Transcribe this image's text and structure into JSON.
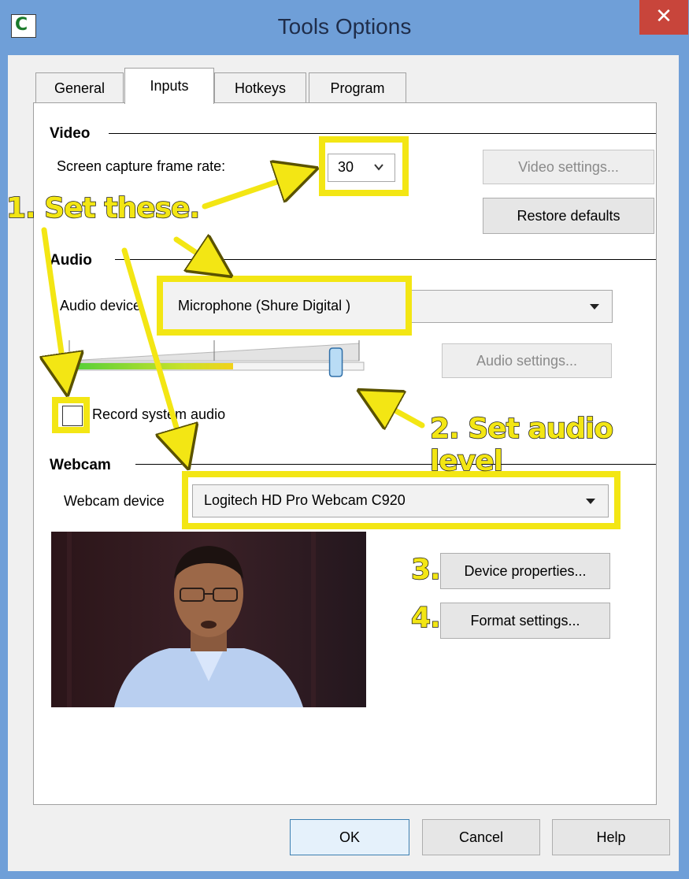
{
  "window": {
    "title": "Tools Options",
    "close_glyph": "✕",
    "app_icon_glyph": "C"
  },
  "tabs": [
    {
      "label": "General",
      "active": false
    },
    {
      "label": "Inputs",
      "active": true
    },
    {
      "label": "Hotkeys",
      "active": false
    },
    {
      "label": "Program",
      "active": false
    }
  ],
  "video": {
    "section_title": "Video",
    "frame_rate_label": "Screen capture frame rate:",
    "frame_rate_value": "30",
    "video_settings_label": "Video settings...",
    "restore_defaults_label": "Restore defaults"
  },
  "audio": {
    "section_title": "Audio",
    "device_label": "Audio device",
    "device_value": "Microphone (Shure Digital   )",
    "audio_settings_label": "Audio settings...",
    "level": 0.92,
    "meter_fill": 0.56,
    "record_system_audio_label": "Record system audio",
    "record_system_audio_checked": false
  },
  "webcam": {
    "section_title": "Webcam",
    "device_label": "Webcam device",
    "device_value": "Logitech HD Pro Webcam C920",
    "device_properties_label": "Device properties...",
    "format_settings_label": "Format settings..."
  },
  "footer": {
    "ok_label": "OK",
    "cancel_label": "Cancel",
    "help_label": "Help"
  },
  "annotations": {
    "step1": "1. Set these.",
    "step2": "2. Set audio level",
    "step3": "3.",
    "step4": "4."
  },
  "colors": {
    "highlight": "#f3e614",
    "title_bar": "#6f9fd8",
    "close_button": "#c8453b"
  }
}
